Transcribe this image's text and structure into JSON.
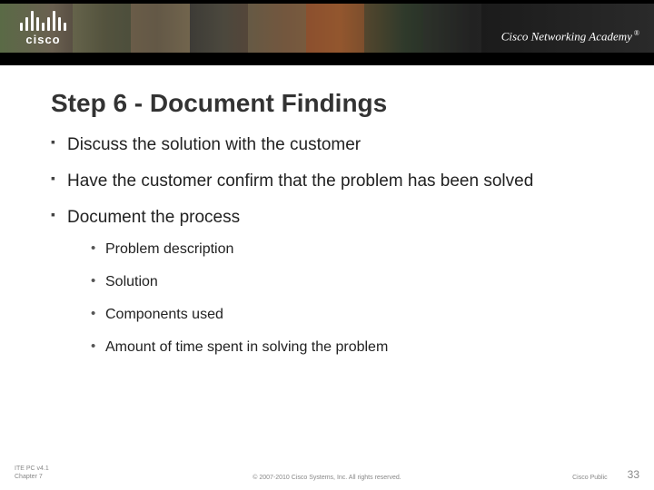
{
  "header": {
    "logo_text": "cisco",
    "academy_text": "Cisco Networking Academy",
    "academy_mark": "®"
  },
  "title": "Step 6 - Document Findings",
  "bullets": [
    {
      "text": "Discuss the solution with the customer"
    },
    {
      "text": "Have the customer confirm that the problem has been solved"
    },
    {
      "text": "Document the process",
      "sub": [
        "Problem description",
        "Solution",
        "Components used",
        "Amount of time spent in solving the problem"
      ]
    }
  ],
  "footer": {
    "left_line1": "ITE PC v4.1",
    "left_line2": "Chapter 7",
    "copyright": "© 2007-2010 Cisco Systems, Inc. All rights reserved.",
    "public": "Cisco Public",
    "slide_number": "33"
  }
}
